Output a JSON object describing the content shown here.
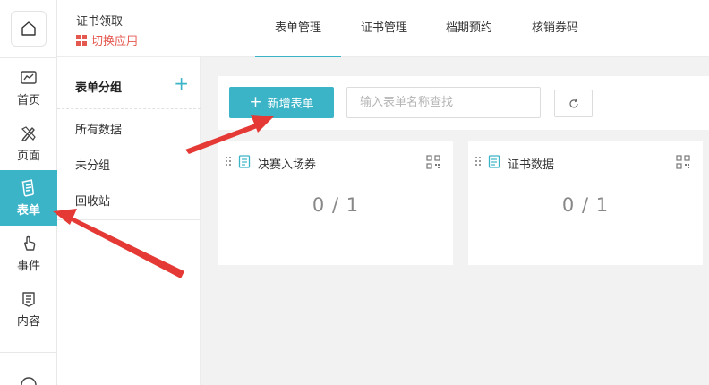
{
  "header": {
    "app_title": "证书领取",
    "switch_app": "切换应用",
    "tabs": [
      "表单管理",
      "证书管理",
      "档期预约",
      "核销券码"
    ],
    "active_tab": "表单管理"
  },
  "sidebar": {
    "items": [
      {
        "label": "首页",
        "icon": "chart-icon"
      },
      {
        "label": "页面",
        "icon": "pen-ruler-icon"
      },
      {
        "label": "表单",
        "icon": "form-icon",
        "active": true
      },
      {
        "label": "事件",
        "icon": "pointer-icon"
      },
      {
        "label": "内容",
        "icon": "content-icon"
      }
    ]
  },
  "groups": {
    "title": "表单分组",
    "add": "+",
    "items": [
      "所有数据",
      "未分组",
      "回收站"
    ]
  },
  "toolbar": {
    "new_label": "新增表单",
    "search_placeholder": "输入表单名称查找"
  },
  "cards": [
    {
      "name": "决赛入场券",
      "count": "0 / 1"
    },
    {
      "name": "证书数据",
      "count": "0 / 1"
    }
  ],
  "colors": {
    "accent": "#3cb4c8",
    "switch": "#e4584f",
    "arrow": "#e53935"
  }
}
